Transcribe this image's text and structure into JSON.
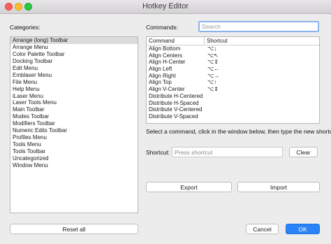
{
  "window": {
    "title": "Hotkey Editor"
  },
  "categories": {
    "label": "Categories:",
    "items": [
      "Arrange (long) Toolbar",
      "Arrange Menu",
      "Color Palette Toolbar",
      "Docking Toolbar",
      "Edit Menu",
      "Emblaser Menu",
      "File Menu",
      "Help Menu",
      "iLaser Menu",
      "Laser Tools Menu",
      "Main Toolbar",
      "Modes Toolbar",
      "Modifiers Toolbar",
      "Numeric Edits Toolbar",
      "Profiles Menu",
      "Tools Menu",
      "Tools Toolbar",
      "Uncategorized",
      "Window Menu"
    ],
    "selected_index": 0
  },
  "commands": {
    "label": "Commands:",
    "search_placeholder": "Search",
    "columns": [
      "Command",
      "Shortcut"
    ],
    "rows": [
      [
        "Align Bottom",
        "⌥↓"
      ],
      [
        "Align Centers",
        "⌥↖"
      ],
      [
        "Align H-Center",
        "⌥⇕"
      ],
      [
        "Align Left",
        "⌥←"
      ],
      [
        "Align Right",
        "⌥→"
      ],
      [
        "Align Top",
        "⌥↑"
      ],
      [
        "Align V-Center",
        "⌥⇕"
      ],
      [
        "Distribute H-Centered",
        ""
      ],
      [
        "Distribute H-Spaced",
        ""
      ],
      [
        "Distribute V-Centered",
        ""
      ],
      [
        "Distribute V-Spaced",
        ""
      ]
    ]
  },
  "instruction": "Select a command, click in the window below, then type the new shortcut",
  "shortcut": {
    "label": "Shortcut:",
    "placeholder": "Press shortcut",
    "clear_label": "Clear"
  },
  "buttons": {
    "export": "Export",
    "import": "Import",
    "reset_all": "Reset all",
    "cancel": "Cancel",
    "ok": "OK"
  }
}
